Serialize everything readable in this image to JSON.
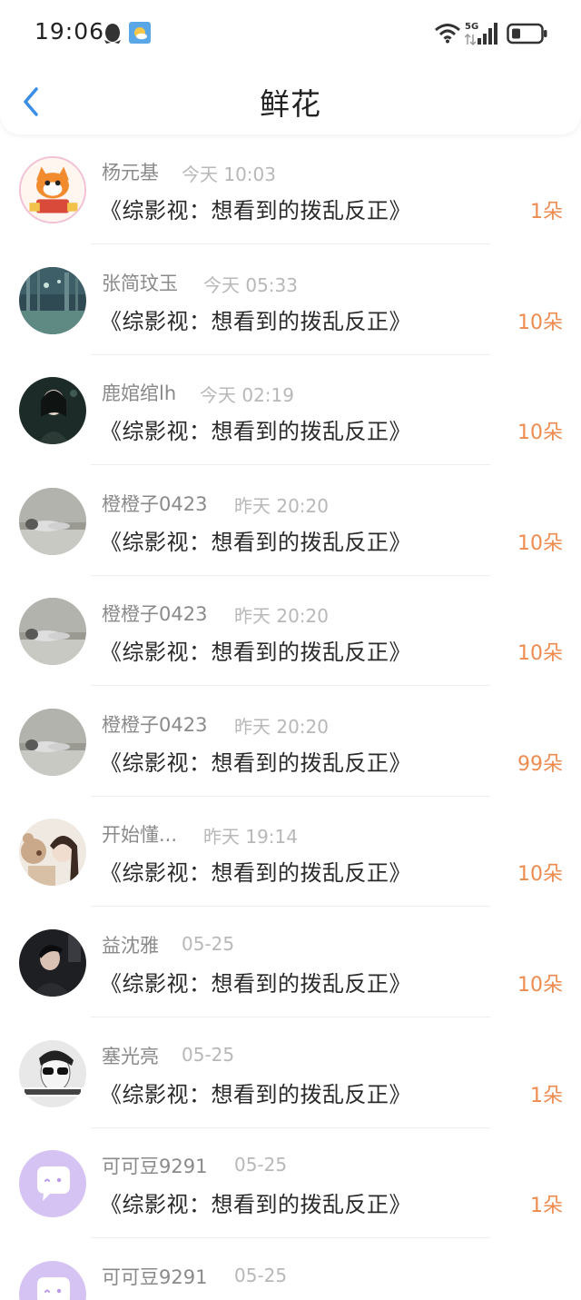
{
  "status_bar": {
    "time": "19:06"
  },
  "nav": {
    "title": "鲜花"
  },
  "items": [
    {
      "name": "杨元基",
      "time": "今天 10:03",
      "book": "《综影视：想看到的拨乱反正》",
      "flowers": "1朵",
      "avatar": "cartoon-fox-avatar"
    },
    {
      "name": "张简玟玉",
      "time": "今天 05:33",
      "book": "《综影视：想看到的拨乱反正》",
      "flowers": "10朵",
      "avatar": "rainy-street-avatar"
    },
    {
      "name": "鹿婠绾lh",
      "time": "今天 02:19",
      "book": "《综影视：想看到的拨乱反正》",
      "flowers": "10朵",
      "avatar": "girl-portrait-avatar"
    },
    {
      "name": "橙橙子0423",
      "time": "昨天 20:20",
      "book": "《综影视：想看到的拨乱反正》",
      "flowers": "10朵",
      "avatar": "cat-avatar"
    },
    {
      "name": "橙橙子0423",
      "time": "昨天 20:20",
      "book": "《综影视：想看到的拨乱反正》",
      "flowers": "10朵",
      "avatar": "cat-avatar"
    },
    {
      "name": "橙橙子0423",
      "time": "昨天 20:20",
      "book": "《综影视：想看到的拨乱反正》",
      "flowers": "99朵",
      "avatar": "cat-avatar"
    },
    {
      "name": "开始懂...",
      "time": "昨天 19:14",
      "book": "《综影视：想看到的拨乱反正》",
      "flowers": "10朵",
      "avatar": "girl-teddy-avatar"
    },
    {
      "name": "益沈雅",
      "time": "05-25",
      "book": "《综影视：想看到的拨乱反正》",
      "flowers": "10朵",
      "avatar": "boy-portrait-avatar"
    },
    {
      "name": "塞光亮",
      "time": "05-25",
      "book": "《综影视：想看到的拨乱反正》",
      "flowers": "1朵",
      "avatar": "sunglasses-avatar"
    },
    {
      "name": "可可豆9291",
      "time": "05-25",
      "book": "《综影视：想看到的拨乱反正》",
      "flowers": "1朵",
      "avatar": "default-chat-avatar"
    },
    {
      "name": "可可豆9291",
      "time": "05-25",
      "book": "",
      "flowers": "",
      "avatar": "default-chat-avatar"
    }
  ],
  "colors": {
    "accent": "#3a8ee6",
    "flowers": "#ee8b4f",
    "name": "#8a8a8a",
    "time": "#b8b8b8"
  }
}
